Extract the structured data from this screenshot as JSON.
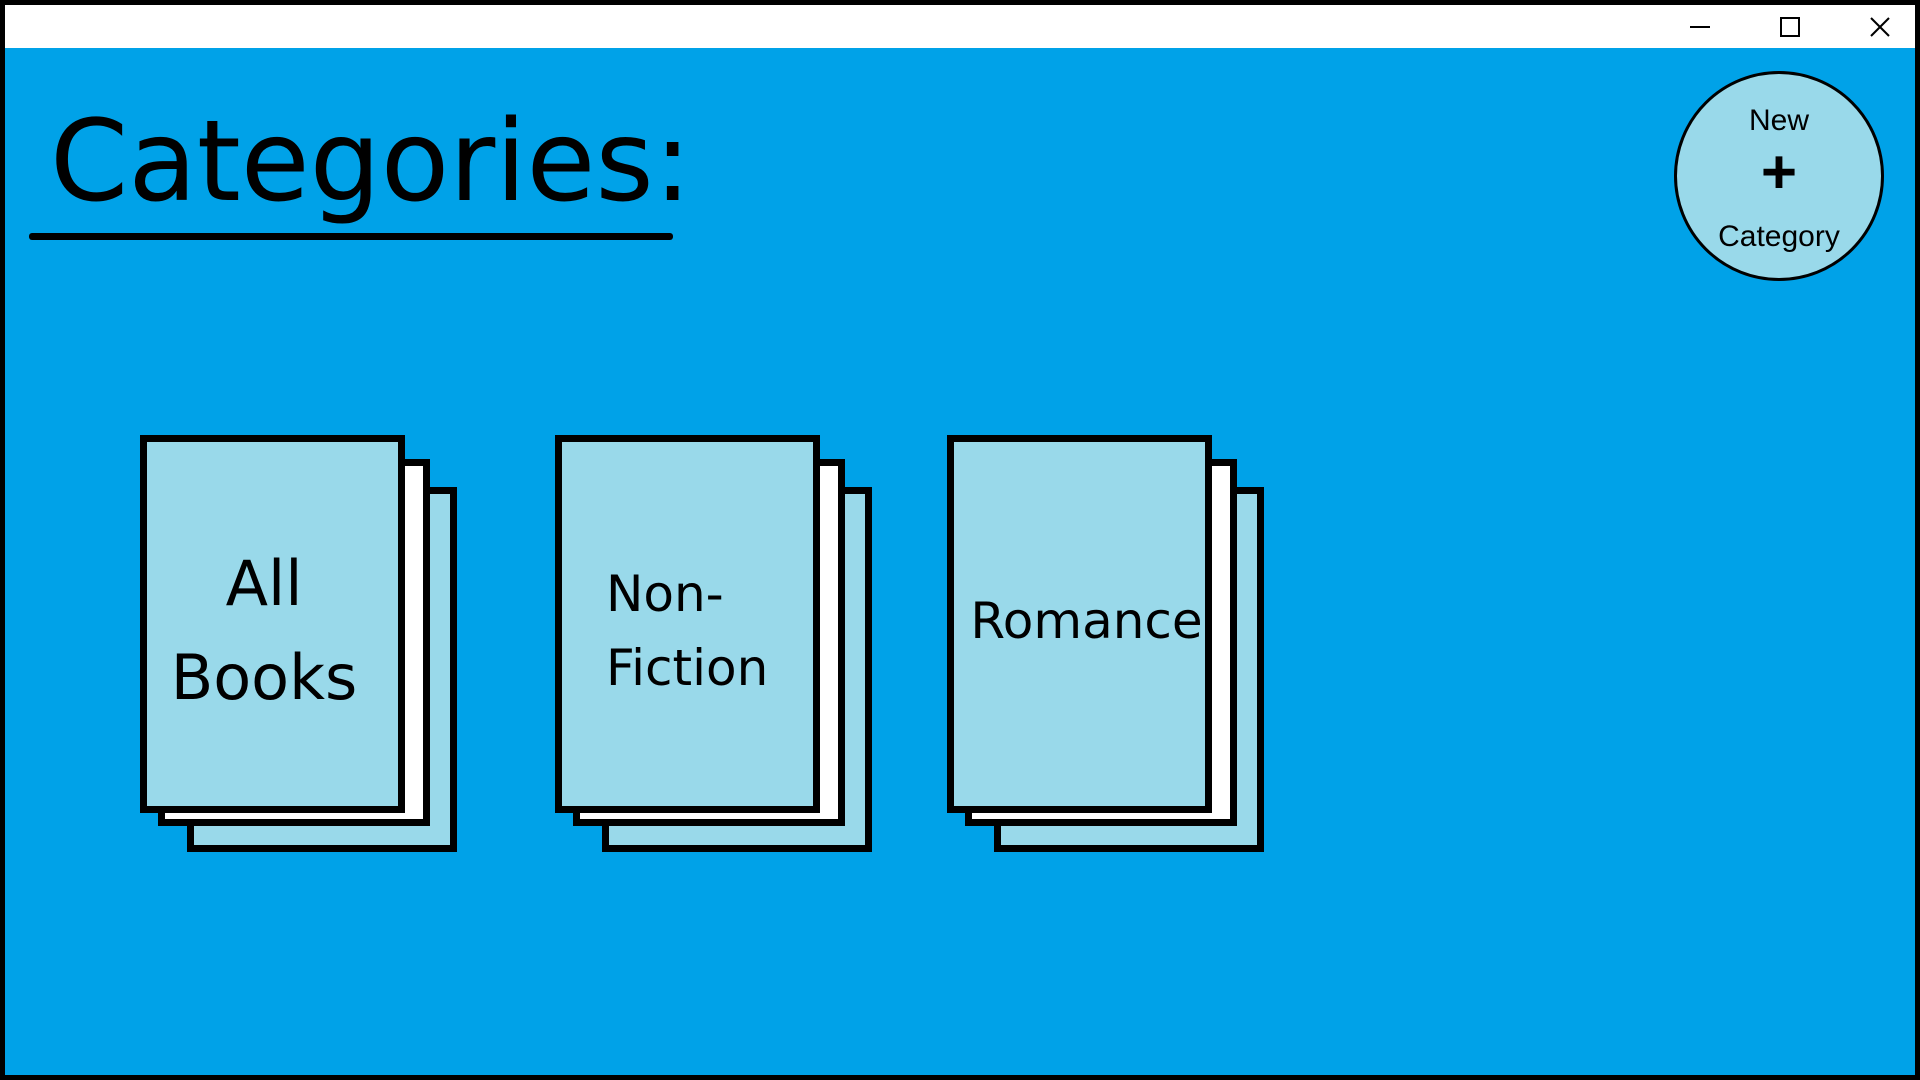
{
  "window": {
    "controls": {
      "minimize_icon": "minimize-icon",
      "maximize_icon": "maximize-icon",
      "close_icon": "close-icon"
    },
    "background_color": "#00A2E8",
    "titlebar_color": "#FFFFFF"
  },
  "header": {
    "title": "Categories:"
  },
  "new_category_button": {
    "line1": "New",
    "symbol": "+",
    "line2": "Category",
    "fill_color": "#99D9EA"
  },
  "categories": [
    {
      "label": "All Books"
    },
    {
      "label": "Non-Fiction"
    },
    {
      "label": "Romance"
    }
  ],
  "card_colors": {
    "front": "#99D9EA",
    "middle": "#FFFFFF",
    "back": "#99D9EA",
    "border": "#000000"
  }
}
